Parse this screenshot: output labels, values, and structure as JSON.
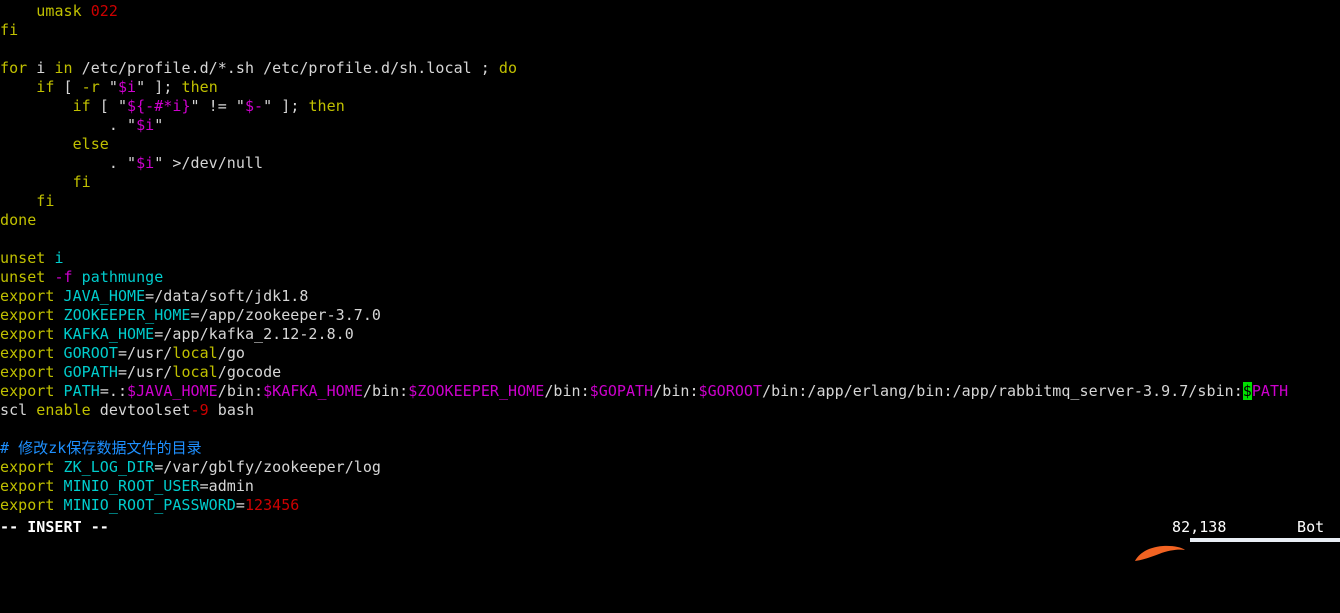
{
  "terminal": {
    "background": "#000000",
    "foreground": "#d6d6d6",
    "font_size_px": 15,
    "cols": 166,
    "rows": 28
  },
  "palette": {
    "keyword_yellow": "#c0c000",
    "identifier_cyan": "#00cdcd",
    "variable_magenta": "#cd00cd",
    "number_red": "#cd0000",
    "comment_blue": "#1e90ff",
    "normal_white": "#d6d6d6",
    "cursor_green": "#00e000",
    "status_white": "#ffffff",
    "pointer_orange": "#f26322"
  },
  "editor": {
    "mode_message": "-- INSERT --",
    "ruler": "82,138",
    "file_position": "Bot"
  },
  "lines": [
    {
      "id": "line-1",
      "text": "    umask 022"
    },
    {
      "id": "line-2",
      "text": "fi"
    },
    {
      "id": "line-3",
      "text": ""
    },
    {
      "id": "line-4",
      "text": "for i in /etc/profile.d/*.sh /etc/profile.d/sh.local ; do"
    },
    {
      "id": "line-5",
      "text": "    if [ -r \"$i\" ]; then"
    },
    {
      "id": "line-6",
      "text": "        if [ \"${-#*i}\" != \"$-\" ]; then"
    },
    {
      "id": "line-7",
      "text": "            . \"$i\""
    },
    {
      "id": "line-8",
      "text": "        else"
    },
    {
      "id": "line-9",
      "text": "            . \"$i\" >/dev/null"
    },
    {
      "id": "line-10",
      "text": "        fi"
    },
    {
      "id": "line-11",
      "text": "    fi"
    },
    {
      "id": "line-12",
      "text": "done"
    },
    {
      "id": "line-13",
      "text": ""
    },
    {
      "id": "line-14",
      "text": "unset i"
    },
    {
      "id": "line-15",
      "text": "unset -f pathmunge"
    },
    {
      "id": "line-16",
      "text": "export JAVA_HOME=/data/soft/jdk1.8"
    },
    {
      "id": "line-17",
      "text": "export ZOOKEEPER_HOME=/app/zookeeper-3.7.0"
    },
    {
      "id": "line-18",
      "text": "export KAFKA_HOME=/app/kafka_2.12-2.8.0"
    },
    {
      "id": "line-19",
      "text": "export GOROOT=/usr/local/go"
    },
    {
      "id": "line-20",
      "text": "export GOPATH=/usr/local/gocode"
    },
    {
      "id": "line-21",
      "text": "export PATH=.:$JAVA_HOME/bin:$KAFKA_HOME/bin:$ZOOKEEPER_HOME/bin:$GOPATH/bin:$GOROOT/bin:/app/erlang/bin:/app/rabbitmq_server-3.9.7/sbin:$PATH"
    },
    {
      "id": "line-22",
      "text": "scl enable devtoolset-9 bash"
    },
    {
      "id": "line-23",
      "text": ""
    },
    {
      "id": "line-24",
      "text": "# 修改zk保存数据文件的目录"
    },
    {
      "id": "line-25",
      "text": "export ZK_LOG_DIR=/var/gblfy/zookeeper/log"
    },
    {
      "id": "line-26",
      "text": "export MINIO_ROOT_USER=admin"
    },
    {
      "id": "line-27",
      "text": "export MINIO_ROOT_PASSWORD=123456"
    }
  ],
  "tokens": {
    "line_1": [
      {
        "t": "    ",
        "c": "normal"
      },
      {
        "t": "umask",
        "c": "keyword"
      },
      {
        "t": " ",
        "c": "normal"
      },
      {
        "t": "022",
        "c": "number"
      }
    ],
    "line_2": [
      {
        "t": "fi",
        "c": "keyword"
      }
    ],
    "line_4": [
      {
        "t": "for",
        "c": "keyword"
      },
      {
        "t": " i ",
        "c": "normal"
      },
      {
        "t": "in",
        "c": "keyword"
      },
      {
        "t": " /etc/profile.d/*.sh /etc/profile.d/sh.local ; ",
        "c": "normal"
      },
      {
        "t": "do",
        "c": "keyword"
      }
    ],
    "line_5": [
      {
        "t": "    ",
        "c": "normal"
      },
      {
        "t": "if",
        "c": "keyword"
      },
      {
        "t": " [ ",
        "c": "normal"
      },
      {
        "t": "-r",
        "c": "keyword"
      },
      {
        "t": " \"",
        "c": "normal"
      },
      {
        "t": "$i",
        "c": "var"
      },
      {
        "t": "\" ]; ",
        "c": "normal"
      },
      {
        "t": "then",
        "c": "keyword"
      }
    ],
    "line_6": [
      {
        "t": "        ",
        "c": "normal"
      },
      {
        "t": "if",
        "c": "keyword"
      },
      {
        "t": " [ \"",
        "c": "normal"
      },
      {
        "t": "${-#*i}",
        "c": "var"
      },
      {
        "t": "\" != \"",
        "c": "normal"
      },
      {
        "t": "$-",
        "c": "var"
      },
      {
        "t": "\" ]; ",
        "c": "normal"
      },
      {
        "t": "then",
        "c": "keyword"
      }
    ],
    "line_7": [
      {
        "t": "            . \"",
        "c": "normal"
      },
      {
        "t": "$i",
        "c": "var"
      },
      {
        "t": "\"",
        "c": "normal"
      }
    ],
    "line_8": [
      {
        "t": "        ",
        "c": "normal"
      },
      {
        "t": "else",
        "c": "keyword"
      }
    ],
    "line_9": [
      {
        "t": "            . \"",
        "c": "normal"
      },
      {
        "t": "$i",
        "c": "var"
      },
      {
        "t": "\" >/dev/null",
        "c": "normal"
      }
    ],
    "line_10": [
      {
        "t": "        ",
        "c": "normal"
      },
      {
        "t": "fi",
        "c": "keyword"
      }
    ],
    "line_11": [
      {
        "t": "    ",
        "c": "normal"
      },
      {
        "t": "fi",
        "c": "keyword"
      }
    ],
    "line_12": [
      {
        "t": "done",
        "c": "keyword"
      }
    ],
    "line_14": [
      {
        "t": "unset",
        "c": "keyword"
      },
      {
        "t": " ",
        "c": "normal"
      },
      {
        "t": "i",
        "c": "ident"
      }
    ],
    "line_15": [
      {
        "t": "unset",
        "c": "keyword"
      },
      {
        "t": " ",
        "c": "normal"
      },
      {
        "t": "-f",
        "c": "var"
      },
      {
        "t": " ",
        "c": "normal"
      },
      {
        "t": "pathmunge",
        "c": "ident"
      }
    ],
    "line_16": [
      {
        "t": "export",
        "c": "keyword"
      },
      {
        "t": " ",
        "c": "normal"
      },
      {
        "t": "JAVA_HOME",
        "c": "ident"
      },
      {
        "t": "=/data/soft/jdk1.8",
        "c": "normal"
      }
    ],
    "line_17": [
      {
        "t": "export",
        "c": "keyword"
      },
      {
        "t": " ",
        "c": "normal"
      },
      {
        "t": "ZOOKEEPER_HOME",
        "c": "ident"
      },
      {
        "t": "=/app/zookeeper-3.7.0",
        "c": "normal"
      }
    ],
    "line_18": [
      {
        "t": "export",
        "c": "keyword"
      },
      {
        "t": " ",
        "c": "normal"
      },
      {
        "t": "KAFKA_HOME",
        "c": "ident"
      },
      {
        "t": "=/app/kafka_2.12-2.8.0",
        "c": "normal"
      }
    ],
    "line_19": [
      {
        "t": "export",
        "c": "keyword"
      },
      {
        "t": " ",
        "c": "normal"
      },
      {
        "t": "GOROOT",
        "c": "ident"
      },
      {
        "t": "=/usr/",
        "c": "normal"
      },
      {
        "t": "local",
        "c": "keyword"
      },
      {
        "t": "/go",
        "c": "normal"
      }
    ],
    "line_20": [
      {
        "t": "export",
        "c": "keyword"
      },
      {
        "t": " ",
        "c": "normal"
      },
      {
        "t": "GOPATH",
        "c": "ident"
      },
      {
        "t": "=/usr/",
        "c": "normal"
      },
      {
        "t": "local",
        "c": "keyword"
      },
      {
        "t": "/gocode",
        "c": "normal"
      }
    ],
    "line_21": [
      {
        "t": "export",
        "c": "keyword"
      },
      {
        "t": " ",
        "c": "normal"
      },
      {
        "t": "PATH",
        "c": "ident"
      },
      {
        "t": "=.:",
        "c": "normal"
      },
      {
        "t": "$JAVA_HOME",
        "c": "var"
      },
      {
        "t": "/bin:",
        "c": "normal"
      },
      {
        "t": "$KAFKA_HOME",
        "c": "var"
      },
      {
        "t": "/bin:",
        "c": "normal"
      },
      {
        "t": "$ZOOKEEPER_HOME",
        "c": "var"
      },
      {
        "t": "/bin:",
        "c": "normal"
      },
      {
        "t": "$GOPATH",
        "c": "var"
      },
      {
        "t": "/bin:",
        "c": "normal"
      },
      {
        "t": "$GOROOT",
        "c": "var"
      },
      {
        "t": "/bin:/app/erlang/bin:/app/rabbitmq_server-3.9.7/sbin:",
        "c": "normal"
      },
      {
        "t": "$",
        "c": "cursor"
      },
      {
        "t": "PATH",
        "c": "var"
      }
    ],
    "line_22": [
      {
        "t": "scl ",
        "c": "normal"
      },
      {
        "t": "enable",
        "c": "keyword"
      },
      {
        "t": " devtoolset",
        "c": "normal"
      },
      {
        "t": "-9",
        "c": "number"
      },
      {
        "t": " bash",
        "c": "normal"
      }
    ],
    "line_24": [
      {
        "t": "# 修改zk保存数据文件的目录",
        "c": "comment"
      }
    ],
    "line_25": [
      {
        "t": "export",
        "c": "keyword"
      },
      {
        "t": " ",
        "c": "normal"
      },
      {
        "t": "ZK_LOG_DIR",
        "c": "ident"
      },
      {
        "t": "=/var/gblfy/zookeeper/log",
        "c": "normal"
      }
    ],
    "line_26": [
      {
        "t": "export",
        "c": "keyword"
      },
      {
        "t": " ",
        "c": "normal"
      },
      {
        "t": "MINIO_ROOT_USER",
        "c": "ident"
      },
      {
        "t": "=admin",
        "c": "normal"
      }
    ],
    "line_27": [
      {
        "t": "export",
        "c": "keyword"
      },
      {
        "t": " ",
        "c": "normal"
      },
      {
        "t": "MINIO_ROOT_PASSWORD",
        "c": "ident"
      },
      {
        "t": "=",
        "c": "normal"
      },
      {
        "t": "123456",
        "c": "number"
      }
    ]
  }
}
